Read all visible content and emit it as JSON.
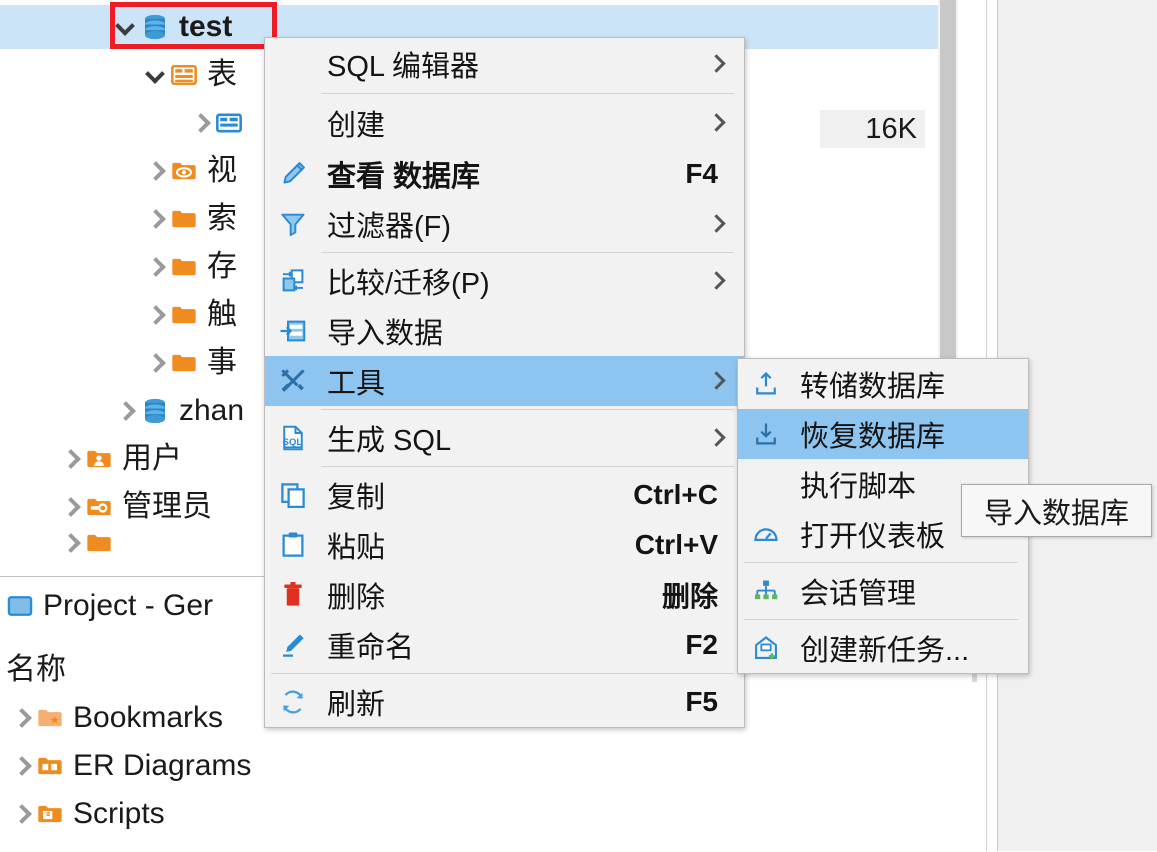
{
  "tree": {
    "header_partial_icon": "chevron-down-icon",
    "selected_node": {
      "label": "test",
      "icon": "database-icon",
      "expanded": true,
      "highlighted": true,
      "annotated": true
    },
    "annotation": {
      "type": "red-rectangle",
      "color": "#ee1c25"
    },
    "children": [
      {
        "label": "表",
        "icon": "tables-folder-icon",
        "expanded": true,
        "depth": 2
      },
      {
        "label": "",
        "icon": "table-icon",
        "expanded": false,
        "depth": 3
      },
      {
        "label": "视",
        "icon": "views-folder-icon",
        "expanded": false,
        "depth": 2
      },
      {
        "label": "索",
        "icon": "folder-icon",
        "expanded": false,
        "depth": 2
      },
      {
        "label": "存",
        "icon": "folder-icon",
        "expanded": false,
        "depth": 2
      },
      {
        "label": "触",
        "icon": "folder-icon",
        "expanded": false,
        "depth": 2
      },
      {
        "label": "事",
        "icon": "folder-icon",
        "expanded": false,
        "depth": 2
      },
      {
        "label": "zhan",
        "icon": "database-icon",
        "expanded": false,
        "depth": 2
      },
      {
        "label": "用户",
        "icon": "users-folder-icon",
        "expanded": false,
        "depth": 1
      },
      {
        "label": "管理员",
        "icon": "admin-folder-icon",
        "expanded": false,
        "depth": 1
      }
    ],
    "size_cell": "16K"
  },
  "bottom_panel": {
    "title": "Project - Ger",
    "title_icon": "project-icon",
    "column_header": "名称",
    "items": [
      {
        "label": "Bookmarks",
        "icon": "bookmarks-folder-icon"
      },
      {
        "label": "ER Diagrams",
        "icon": "er-diagrams-folder-icon"
      },
      {
        "label": "Scripts",
        "icon": "scripts-folder-icon"
      }
    ]
  },
  "context_menu": {
    "items": [
      {
        "label": "SQL 编辑器",
        "icon": null,
        "accel": "",
        "submenu": true,
        "bold": false,
        "highlighted": false,
        "separator_after": true
      },
      {
        "label": "创建",
        "icon": null,
        "accel": "",
        "submenu": true,
        "bold": false,
        "highlighted": false,
        "separator_after": false
      },
      {
        "label": "查看 数据库",
        "icon": "pencil-icon",
        "accel": "F4",
        "submenu": false,
        "bold": true,
        "highlighted": false,
        "separator_after": false
      },
      {
        "label": "过滤器(F)",
        "icon": "filter-icon",
        "accel": "",
        "submenu": true,
        "bold": false,
        "highlighted": false,
        "separator_after": true
      },
      {
        "label": "比较/迁移(P)",
        "icon": "compare-icon",
        "accel": "",
        "submenu": true,
        "bold": false,
        "highlighted": false,
        "separator_after": false
      },
      {
        "label": "导入数据",
        "icon": "import-data-icon",
        "accel": "",
        "submenu": false,
        "bold": false,
        "highlighted": false,
        "separator_after": false
      },
      {
        "label": "工具",
        "icon": "tools-icon",
        "accel": "",
        "submenu": true,
        "bold": false,
        "highlighted": true,
        "separator_after": true
      },
      {
        "label": "生成 SQL",
        "icon": "generate-sql-icon",
        "accel": "",
        "submenu": true,
        "bold": false,
        "highlighted": false,
        "separator_after": true
      },
      {
        "label": "复制",
        "icon": "copy-icon",
        "accel": "Ctrl+C",
        "submenu": false,
        "bold": false,
        "highlighted": false,
        "separator_after": false
      },
      {
        "label": "粘贴",
        "icon": "paste-icon",
        "accel": "Ctrl+V",
        "submenu": false,
        "bold": false,
        "highlighted": false,
        "separator_after": false
      },
      {
        "label": "删除",
        "icon": "trash-icon",
        "accel": "删除",
        "submenu": false,
        "bold": false,
        "highlighted": false,
        "separator_after": false
      },
      {
        "label": "重命名",
        "icon": "rename-icon",
        "accel": "F2",
        "submenu": false,
        "bold": false,
        "highlighted": false,
        "separator_after": true
      },
      {
        "label": "刷新",
        "icon": "refresh-icon",
        "accel": "F5",
        "submenu": false,
        "bold": false,
        "highlighted": false,
        "separator_after": false
      }
    ]
  },
  "sub_menu": {
    "items": [
      {
        "label": "转储数据库",
        "icon": "upload-icon",
        "highlighted": false,
        "separator_after": false
      },
      {
        "label": "恢复数据库",
        "icon": "download-icon",
        "highlighted": true,
        "separator_after": false
      },
      {
        "label": "执行脚本",
        "icon": null,
        "highlighted": false,
        "separator_after": false
      },
      {
        "label": "打开仪表板",
        "icon": "dashboard-icon",
        "highlighted": false,
        "separator_after": true
      },
      {
        "label": "会话管理",
        "icon": "sessions-icon",
        "highlighted": false,
        "separator_after": true
      },
      {
        "label": "创建新任务...",
        "icon": "new-task-icon",
        "highlighted": false,
        "separator_after": false
      }
    ]
  },
  "tooltip": {
    "text": "导入数据库"
  },
  "colors": {
    "selection_tree": "#cce4f7",
    "selection_menu": "#8ec5f0",
    "menu_bg": "#f2f2f2",
    "annotation_red": "#ee1c25",
    "folder_orange": "#ef8c20",
    "icon_blue": "#4a9fe0"
  }
}
